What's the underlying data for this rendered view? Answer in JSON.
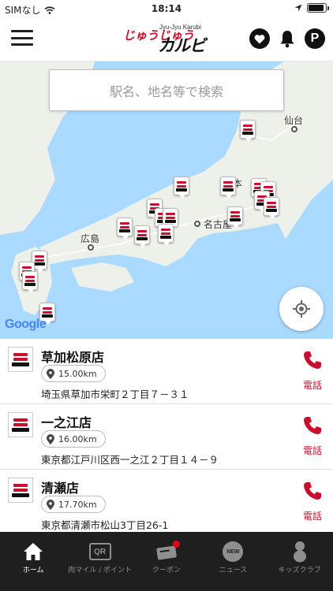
{
  "status_bar": {
    "carrier": "SIMなし",
    "time": "18:14",
    "battery_level": 0.9
  },
  "header": {
    "logo_sub": "Jyu-Jyu Karubi",
    "logo_main_a": "じゅうじゅう",
    "logo_main_b": "カルビ",
    "points_label": "P"
  },
  "map": {
    "search_placeholder": "駅名、地名等で検索",
    "cities": {
      "sendai": "仙台",
      "hiroshima": "広島",
      "nagoya": "名古屋",
      "honshu": "本"
    },
    "attribution": "Google"
  },
  "stores": [
    {
      "name": "草加松原店",
      "distance": "15.00km",
      "address": "埼玉県草加市栄町２丁目７－３１",
      "call_label": "電話"
    },
    {
      "name": "一之江店",
      "distance": "16.00km",
      "address": "東京都江戸川区西一之江２丁目１４－９",
      "call_label": "電話"
    },
    {
      "name": "清瀬店",
      "distance": "17.70km",
      "address": "東京都清瀬市松山3丁目26-1",
      "call_label": "電話"
    }
  ],
  "tabbar": {
    "tabs": [
      {
        "label": "ホーム",
        "active": true
      },
      {
        "label": "肉マイル / ポイント",
        "icon_text": "QR"
      },
      {
        "label": "クーポン"
      },
      {
        "label": "ニュース",
        "icon_text": "NEW"
      },
      {
        "label": "キッズクラブ"
      }
    ]
  },
  "colors": {
    "brand_red": "#c8102e",
    "tabbar_bg": "#1f1f1f",
    "water": "#aadaff",
    "land": "#eef0ea"
  }
}
